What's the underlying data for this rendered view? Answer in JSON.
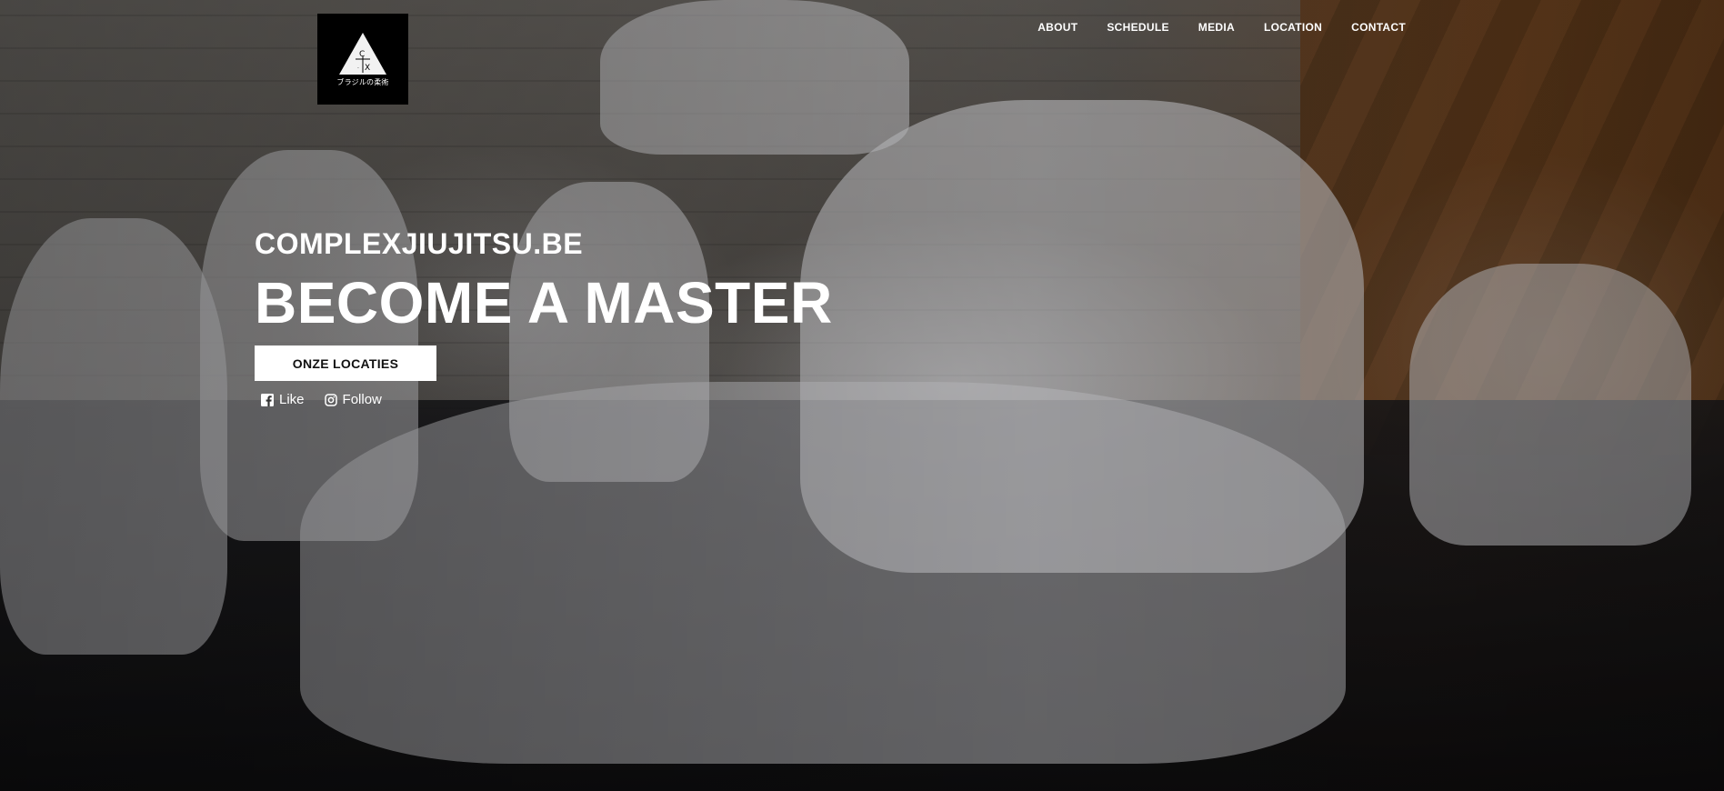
{
  "logo": {
    "letters_top": "C",
    "letters_bottom": "X",
    "dot_left": "·",
    "tagline": "ブラジルの柔術"
  },
  "nav": {
    "items": [
      {
        "label": "ABOUT"
      },
      {
        "label": "SCHEDULE"
      },
      {
        "label": "MEDIA"
      },
      {
        "label": "LOCATION"
      },
      {
        "label": "CONTACT"
      }
    ]
  },
  "hero": {
    "site_name": "COMPLEXJIUJITSU.BE",
    "headline": "BECOME A MASTER",
    "cta_label": "ONZE LOCATIES"
  },
  "social": {
    "facebook_label": "Like",
    "instagram_label": "Follow"
  },
  "colors": {
    "text": "#ffffff",
    "logo_bg": "#000000",
    "cta_bg": "#ffffff",
    "cta_text": "#111111"
  }
}
